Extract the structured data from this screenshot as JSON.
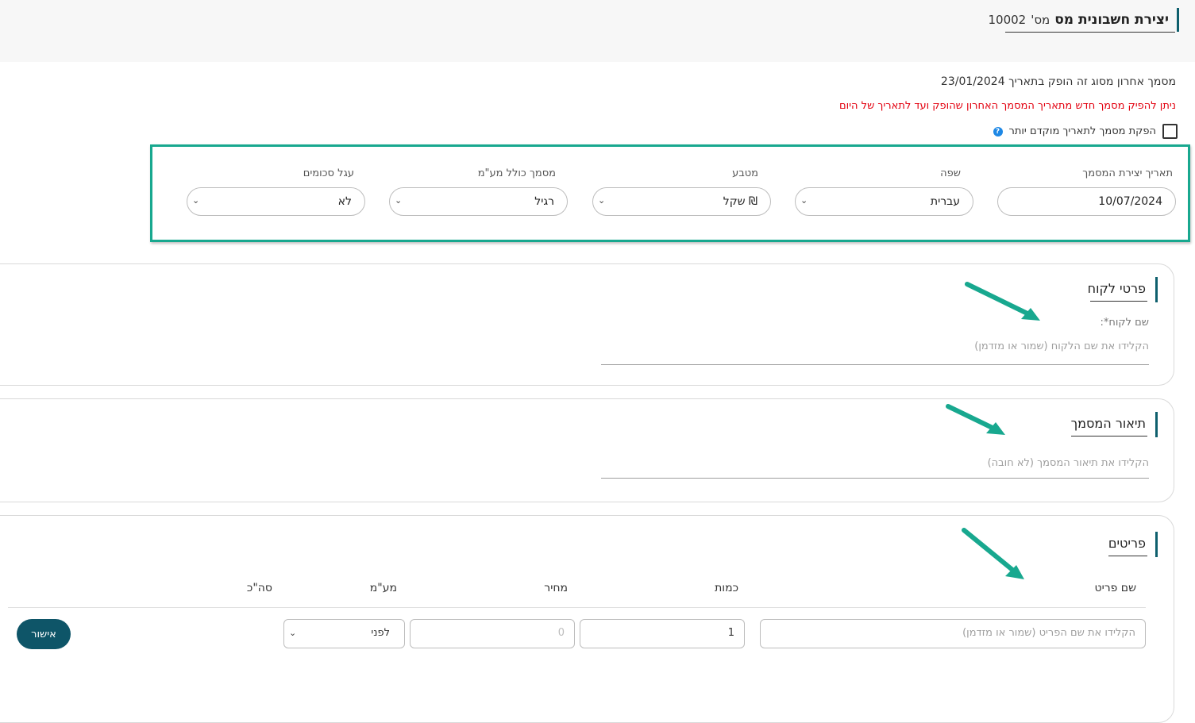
{
  "header": {
    "title": "יצירת חשבונית מס",
    "number_label": "מס'",
    "number": "10002"
  },
  "info": {
    "last_document": "מסמך אחרון מסוג זה הופק בתאריך 23/01/2024",
    "warning": "ניתן להפיק מסמך חדש מתאריך המסמך האחרון שהופק ועד לתאריך של היום",
    "earlier_date_checkbox": "הפקת מסמך לתאריך מוקדם יותר",
    "help_icon": "?"
  },
  "settings": {
    "date": {
      "label": "תאריך יצירת המסמך",
      "value": "10/07/2024"
    },
    "language": {
      "label": "שפה",
      "value": "עברית"
    },
    "currency": {
      "label": "מטבע",
      "value": "₪ שקל"
    },
    "vat_included": {
      "label": "מסמך כולל מע\"מ",
      "value": "רגיל"
    },
    "rounding": {
      "label": "עגל סכומים",
      "value": "לא"
    }
  },
  "customer": {
    "title": "פרטי לקוח",
    "name_label": "שם לקוח*:",
    "name_placeholder": "הקלידו את שם הלקוח (שמור או מזדמן)"
  },
  "description": {
    "title": "תיאור המסמך",
    "placeholder": "הקלידו את תיאור המסמך (לא חובה)"
  },
  "items": {
    "title": "פריטים",
    "columns": [
      "שם פריט",
      "כמות",
      "מחיר",
      "מע\"מ",
      "סה\"כ"
    ],
    "row": {
      "name_placeholder": "הקלידו את שם הפריט (שמור או מזדמן)",
      "quantity": "1",
      "price_placeholder": "0",
      "vat": "לפני"
    },
    "approve_label": "אישור"
  },
  "colors": {
    "accent": "#18a88f",
    "primary": "#0e5568",
    "warning": "#e3000f"
  }
}
